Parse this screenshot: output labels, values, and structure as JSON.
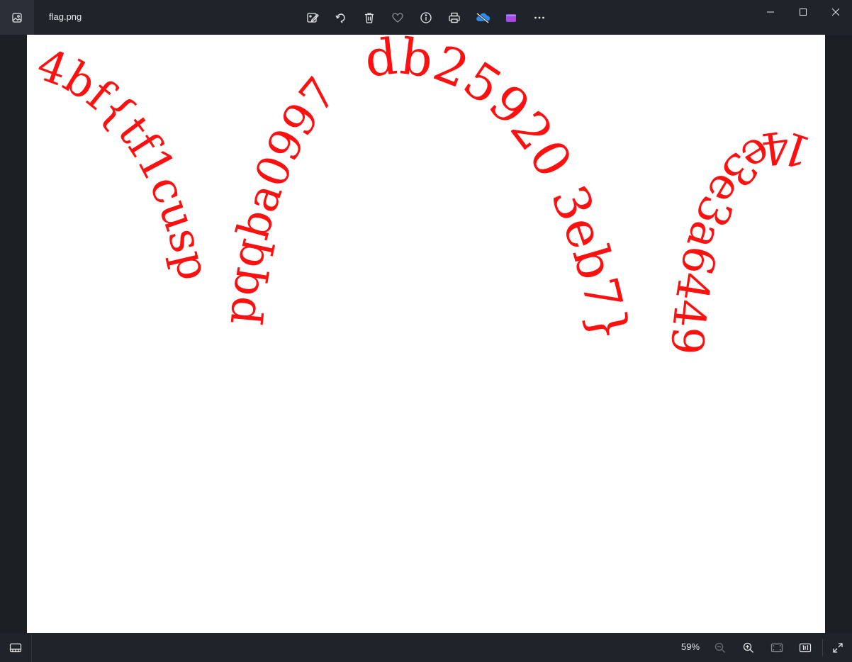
{
  "window": {
    "file_name": "flag.png"
  },
  "toolbar": {
    "items": [
      {
        "name": "edit-image-icon"
      },
      {
        "name": "rotate-icon"
      },
      {
        "name": "delete-icon"
      },
      {
        "name": "favorite-heart-icon"
      },
      {
        "name": "info-icon"
      },
      {
        "name": "print-icon"
      },
      {
        "name": "onedrive-sync-off-icon"
      },
      {
        "name": "clipchamp-video-icon"
      },
      {
        "name": "more-options-icon"
      }
    ]
  },
  "window_controls": [
    "minimize-icon",
    "maximize-icon",
    "close-icon"
  ],
  "image": {
    "text_groups": [
      {
        "text": "4bf{tf1cusp",
        "color": "#ff1010"
      },
      {
        "text": "pqqba0997",
        "color": "#ff1010"
      },
      {
        "text": "db25920 3eb7}",
        "color": "#ff1010"
      },
      {
        "text": "14e3e3a6449",
        "color": "#ff1010"
      }
    ]
  },
  "status": {
    "zoom": "59%"
  },
  "colors": {
    "titlebar": "#1f232a",
    "background": "#1c1f24",
    "flag_text": "#ff1010"
  }
}
